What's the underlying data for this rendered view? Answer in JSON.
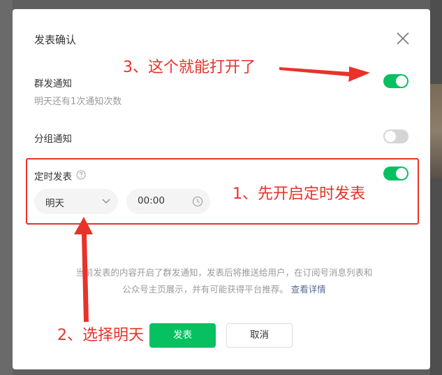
{
  "dialog": {
    "title": "发表确认"
  },
  "group_notify": {
    "label": "群发通知",
    "hint": "明天还有1次通知次数",
    "enabled": true
  },
  "group_by": {
    "label": "分组通知",
    "enabled": false
  },
  "scheduled": {
    "label": "定时发表",
    "enabled": true,
    "date_value": "明天",
    "time_value": "00:00"
  },
  "notice": {
    "text": "当前发表的内容开启了群发通知，发表后将推送给用户，在订阅号消息列表和公众号主页展示，并有可能获得平台推荐。",
    "link": "查看详情"
  },
  "buttons": {
    "publish": "发表",
    "cancel": "取消"
  },
  "annotations": {
    "step1": "1、先开启定时发表",
    "step2": "2、选择明天",
    "step3": "3、这个就能打开了"
  },
  "colors": {
    "accent": "#07c160",
    "annotation": "#e8322a",
    "link": "#576b95"
  }
}
